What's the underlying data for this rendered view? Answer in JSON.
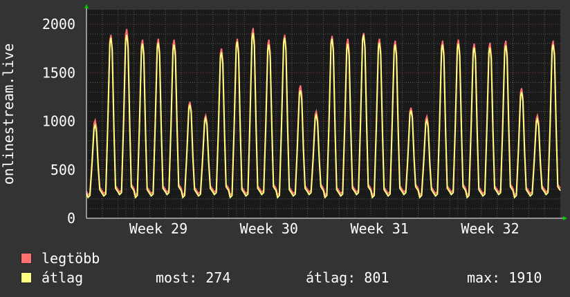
{
  "chart_data": {
    "type": "line",
    "ylabel": "onlinestream.live",
    "yticks": [
      0,
      500,
      1000,
      1500,
      2000
    ],
    "ylim": [
      0,
      2150
    ],
    "xticks": [
      "Week 29",
      "Week 30",
      "Week 31",
      "Week 32"
    ],
    "grid": true,
    "colors": {
      "background": "#333333",
      "plot": "#1a1a1a",
      "grid_major": "#7a3b3b",
      "grid_minor": "#5a5a5a",
      "axis": "#ffffff",
      "max_series": "#ff7070",
      "avg_series": "#ffff80"
    },
    "daily_peaks": [
      {
        "max": 1010,
        "avg": 960
      },
      {
        "max": 1890,
        "avg": 1860
      },
      {
        "max": 1950,
        "avg": 1890
      },
      {
        "max": 1840,
        "avg": 1800
      },
      {
        "max": 1850,
        "avg": 1810
      },
      {
        "max": 1840,
        "avg": 1790
      },
      {
        "max": 1200,
        "avg": 1170
      },
      {
        "max": 1060,
        "avg": 1030
      },
      {
        "max": 1750,
        "avg": 1710
      },
      {
        "max": 1850,
        "avg": 1820
      },
      {
        "max": 1960,
        "avg": 1910
      },
      {
        "max": 1840,
        "avg": 1790
      },
      {
        "max": 1890,
        "avg": 1860
      },
      {
        "max": 1370,
        "avg": 1320
      },
      {
        "max": 1100,
        "avg": 1060
      },
      {
        "max": 1880,
        "avg": 1850
      },
      {
        "max": 1850,
        "avg": 1800
      },
      {
        "max": 1910,
        "avg": 1890
      },
      {
        "max": 1850,
        "avg": 1810
      },
      {
        "max": 1830,
        "avg": 1790
      },
      {
        "max": 1140,
        "avg": 1110
      },
      {
        "max": 1050,
        "avg": 1010
      },
      {
        "max": 1830,
        "avg": 1790
      },
      {
        "max": 1840,
        "avg": 1800
      },
      {
        "max": 1800,
        "avg": 1760
      },
      {
        "max": 1810,
        "avg": 1760
      },
      {
        "max": 1830,
        "avg": 1780
      },
      {
        "max": 1340,
        "avg": 1300
      },
      {
        "max": 1060,
        "avg": 1020
      },
      {
        "max": 1830,
        "avg": 1790
      }
    ],
    "series": [
      {
        "name": "legtöbb"
      },
      {
        "name": "átlag"
      }
    ]
  },
  "legend": {
    "max_label": "legtöbb",
    "avg_label": "átlag",
    "now_text": "most: 274",
    "avg_text": "átlag: 801",
    "max_text": "max: 1910"
  }
}
